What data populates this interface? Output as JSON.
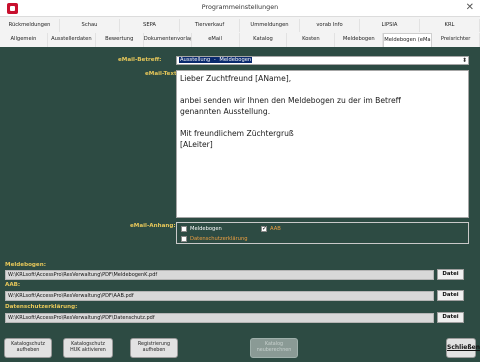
{
  "window": {
    "title": "Programmeinstellungen"
  },
  "tabs_row1": [
    "Rückmeldungen",
    "Schau",
    "SEPA",
    "Tierverkauf",
    "Ummeldungen",
    "vorab Info",
    "LIPSIA",
    "KRL"
  ],
  "tabs_row2": [
    "Allgemein",
    "Ausstellerdaten",
    "Bewertung",
    "Dokumentenvorlagen",
    "eMail",
    "Katalog",
    "Kosten",
    "Meldebogen",
    "Meldebogen (eMail)",
    "Preisrichter"
  ],
  "active_tab": "Meldebogen (eMail)",
  "email": {
    "subject_label": "eMail-Betreff:",
    "subject_part1": "Ausstellung",
    "subject_sep": " - ",
    "subject_part2": "Meldebogen",
    "text_label": "eMail-Text:",
    "body_lines": [
      "Lieber Zuchtfreund [AName],",
      "",
      "anbei senden wir Ihnen den Meldebogen zu der im Betreff",
      "genannten Ausstellung.",
      "",
      "Mit freundlichem Züchtergruß",
      "[ALeiter]"
    ],
    "attachment_label": "eMail-Anhang:",
    "attachments": {
      "meldebogen": {
        "label": "Meldebogen",
        "checked": false
      },
      "aab": {
        "label": "AAB",
        "checked": true
      },
      "datenschutz": {
        "label": "Datenschutzerklärung",
        "checked": false
      }
    }
  },
  "files": {
    "meldebogen_label": "Meldebogen:",
    "meldebogen_path": "W:\\KRLsoft\\AccessPro\\ResVerwaltung\\PDF\\MeldebogenK.pdf",
    "aab_label": "AAB:",
    "aab_path": "W:\\KRLsoft\\AccessPro\\ResVerwaltung\\PDF\\AAB.pdf",
    "datenschutz_label": "Datenschutzerklärung:",
    "datenschutz_path": "W:\\KRLsoft\\AccessPro\\ResVerwaltung\\PDF\\Datenschutz.pdf",
    "datei_button": "Datei"
  },
  "footer": {
    "katalogschutz_aufheben": [
      "Katalogschutz",
      "aufheben"
    ],
    "katalogschutz_huk": [
      "Katalogschutz",
      "HUK aktivieren"
    ],
    "registrierung": [
      "Registrierung",
      "aufheben"
    ],
    "katalog_neuberechnen": [
      "Katalog",
      "neuberechnen"
    ],
    "close": "Schließen"
  },
  "colors": {
    "panel_bg": "#2d4b43",
    "label_yellow": "#e8c85a",
    "subject_highlight": "#fff5a0",
    "orange_text": "#f0a040"
  }
}
